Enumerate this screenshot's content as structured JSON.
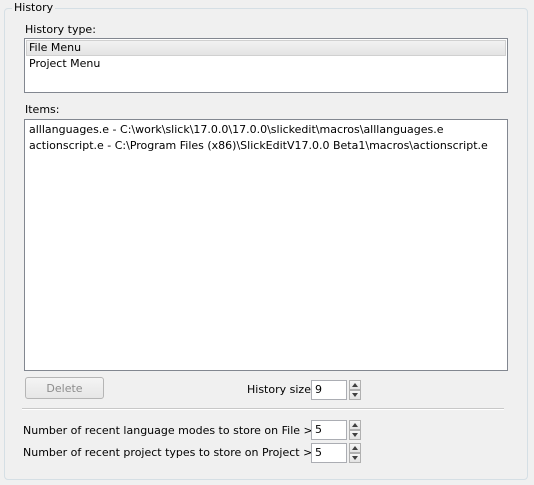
{
  "group": {
    "title": "History"
  },
  "history_type": {
    "label": "History type:",
    "items": [
      "File Menu",
      "Project Menu"
    ],
    "selected_index": 0
  },
  "items": {
    "label": "Items:",
    "rows": [
      "alllanguages.e - C:\\work\\slick\\17.0.0\\17.0.0\\slickedit\\macros\\alllanguages.e",
      "actionscript.e - C:\\Program Files (x86)\\SlickEditV17.0.0 Beta1\\macros\\actionscript.e"
    ]
  },
  "delete_button": {
    "label": "Delete",
    "enabled": false
  },
  "history_size": {
    "label": "History size:",
    "value": "9"
  },
  "recent_language_modes": {
    "label": "Number of recent language modes to store on File > New:",
    "value": "5"
  },
  "recent_project_types": {
    "label": "Number of recent project types to store on Project > New:",
    "value": "5"
  },
  "icons": {
    "spin_up": "triangle-up-icon",
    "spin_down": "triangle-down-icon"
  },
  "colors": {
    "list_border": "#828790",
    "selected_row": "#e8e8e8",
    "disabled_text": "#8c8c8c"
  }
}
